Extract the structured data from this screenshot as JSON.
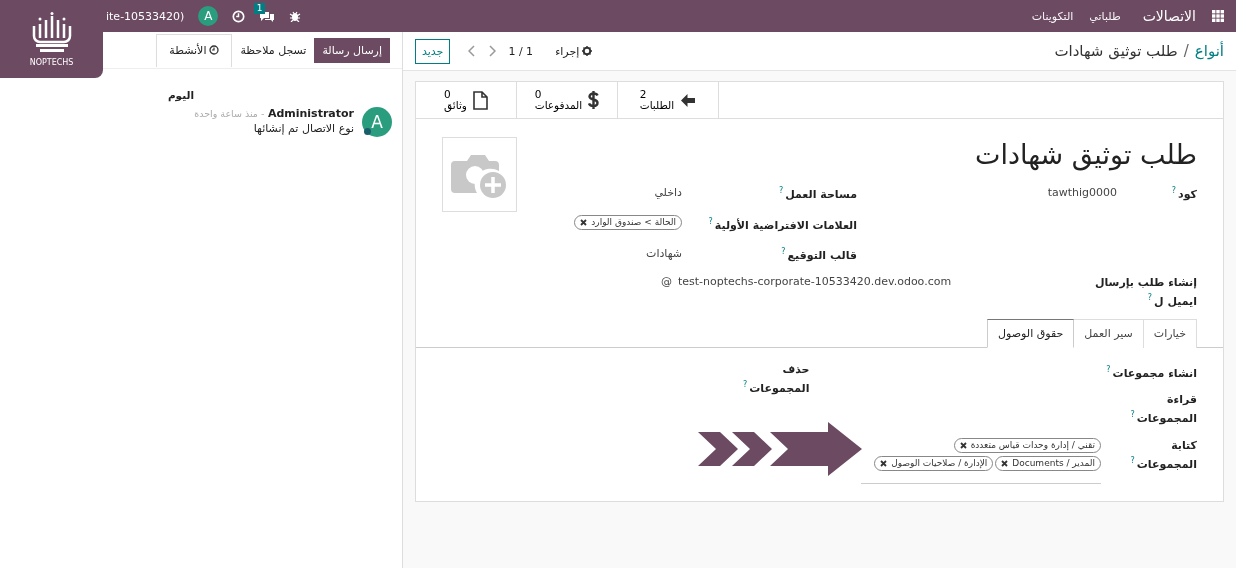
{
  "top_bar": {
    "app_name": "الاتصالات",
    "menu": [
      "طلباتي",
      "التكوينات"
    ],
    "user_name": "ite-10533420)",
    "avatar": "A",
    "chat_badge": "1"
  },
  "logo": {
    "text": "NOPTECHS"
  },
  "chatter": {
    "buttons": [
      {
        "label": "إرسال رسالة",
        "primary": true,
        "kind": "text"
      },
      {
        "label": "تسجل ملاحظة",
        "primary": false,
        "kind": "text"
      },
      {
        "label": "الأنشطة",
        "primary": false,
        "kind": "clock"
      }
    ],
    "date_separator": "اليوم",
    "messages": [
      {
        "avatar": "A",
        "author": "Administrator",
        "time": "- منذ ساعة واحدة",
        "body": "نوع الاتصال تم إنشائها"
      }
    ]
  },
  "control_panel": {
    "breadcrumb": "أنواع",
    "separator": "/",
    "current": "طلب توثيق شهادات",
    "action": "إجراء",
    "pager": "1 / 1",
    "new_button": "جديد"
  },
  "stat_buttons": [
    {
      "value": "2",
      "label": "الطلبات",
      "kind": "arrow"
    },
    {
      "value": "0",
      "label": "المدفوعات",
      "kind": "dollar"
    },
    {
      "value": "0",
      "label": "وثائق",
      "kind": "file"
    }
  ],
  "title": "طلب توثيق شهادات",
  "groups": [
    [
      {
        "label": "كود",
        "help": "?",
        "value": "tawthig0000"
      }
    ],
    [
      {
        "label": "مساحة العمل",
        "help": "?",
        "value": "داخلي"
      },
      {
        "label": "العلامات الافتراضية الأولية",
        "help": "?",
        "tags": [
          "الحالة > صندوق الوارد"
        ]
      },
      {
        "label": "قالب التوقيع",
        "help": "?",
        "value": "شهادات"
      }
    ]
  ],
  "email_field": {
    "label": "إنشاء طلب بإرسال ايميل ل",
    "help": "?",
    "value": "test-noptechs-corporate-10533420.dev.odoo.com",
    "prefix": "@"
  },
  "tabs": [
    {
      "label": "خيارات",
      "selected": false
    },
    {
      "label": "سير العمل",
      "selected": false
    },
    {
      "label": "حقوق الوصول",
      "selected": true
    }
  ],
  "access_groups": [
    [
      {
        "label": "انشاء مجموعات",
        "help": "?"
      },
      {
        "label": "قراءة المجموعات",
        "help": "?"
      },
      {
        "label": "كتابة المجموعات",
        "help": "?",
        "tags": [
          "تقني / إدارة وحدات قياس متعددة",
          "Documents / المدير",
          "الإدارة / صلاحيات الوصول"
        ]
      }
    ],
    [
      {
        "label": "حذف المجموعات",
        "help": "?"
      }
    ]
  ]
}
